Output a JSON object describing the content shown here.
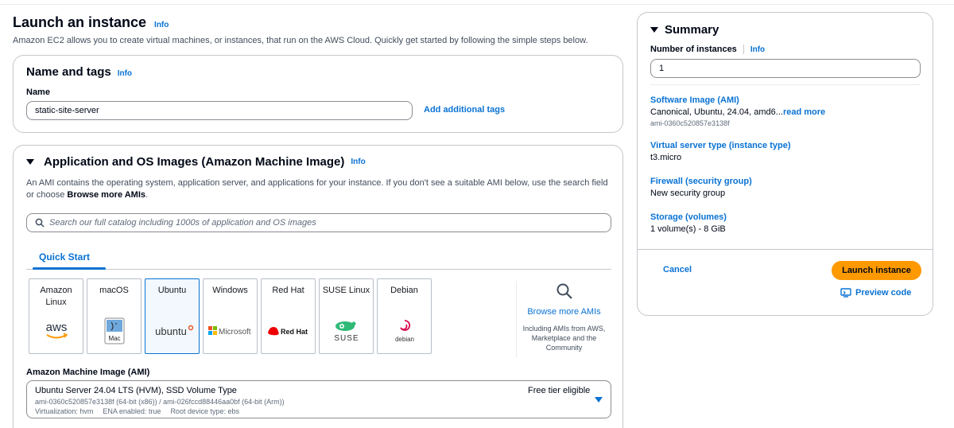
{
  "page": {
    "title": "Launch an instance",
    "info": "Info",
    "description": "Amazon EC2 allows you to create virtual machines, or instances, that run on the AWS Cloud. Quickly get started by following the simple steps below."
  },
  "name_tags": {
    "title": "Name and tags",
    "info": "Info",
    "name_label": "Name",
    "name_value": "static-site-server",
    "add_tags": "Add additional tags"
  },
  "ami_section": {
    "title": "Application and OS Images (Amazon Machine Image)",
    "info": "Info",
    "desc_part1": "An AMI contains the operating system, application server, and applications for your instance. If you don't see a suitable AMI below, use the search field or choose ",
    "desc_bold": "Browse more AMIs",
    "desc_part2": ".",
    "search_placeholder": "Search our full catalog including 1000s of application and OS images",
    "tab_quick_start": "Quick Start",
    "tiles": [
      {
        "name": "Amazon\nLinux",
        "logo": "aws"
      },
      {
        "name": "macOS",
        "logo": "Mac"
      },
      {
        "name": "Ubuntu",
        "logo": "ubuntu"
      },
      {
        "name": "Windows",
        "logo": "Microsoft"
      },
      {
        "name": "Red Hat",
        "logo": "Red Hat"
      },
      {
        "name": "SUSE Linux",
        "logo": "SUSE"
      },
      {
        "name": "Debian",
        "logo": "debian"
      }
    ],
    "selected_index": 2,
    "browse_more": "Browse more AMIs",
    "browse_desc": "Including AMIs from AWS, Marketplace and the Community",
    "ami_label": "Amazon Machine Image (AMI)",
    "ami_name": "Ubuntu Server 24.04 LTS (HVM), SSD Volume Type",
    "ami_ids": "ami-0360c520857e3138f (64-bit (x86)) / ami-026fccd88446aa0bf (64-bit (Arm))",
    "ami_virt": "Virtualization: hvm",
    "ami_ena": "ENA enabled: true",
    "ami_root": "Root device type: ebs",
    "free_tier": "Free tier eligible"
  },
  "summary": {
    "title": "Summary",
    "num_label": "Number of instances",
    "info": "Info",
    "num_value": "1",
    "sections": [
      {
        "label": "Software Image (AMI)",
        "value": "Canonical, Ubuntu, 24.04, amd6...",
        "more": "read more",
        "sub": "ami-0360c520857e3138f"
      },
      {
        "label": "Virtual server type (instance type)",
        "value": "t3.micro"
      },
      {
        "label": "Firewall (security group)",
        "value": "New security group"
      },
      {
        "label": "Storage (volumes)",
        "value": "1 volume(s) - 8 GiB"
      }
    ],
    "cancel": "Cancel",
    "launch": "Launch instance",
    "preview": "Preview code"
  },
  "colors": {
    "link": "#0972d3",
    "primary": "#ff9900",
    "border": "#c6c6cd"
  }
}
